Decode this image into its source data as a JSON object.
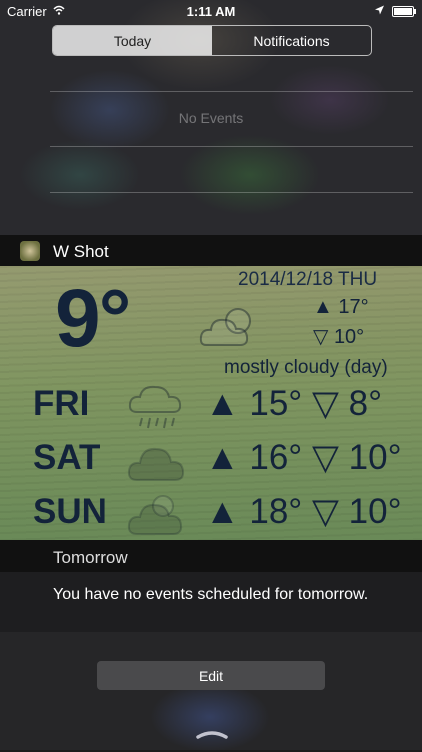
{
  "status": {
    "carrier": "Carrier",
    "time": "1:11 AM"
  },
  "tabs": {
    "today": "Today",
    "notifications": "Notifications"
  },
  "events": {
    "no_events": "No Events"
  },
  "widget": {
    "title": "W Shot",
    "date": "2014/12/18 THU",
    "current_temp": "9°",
    "high": "▲ 17°",
    "low": "▽ 10°",
    "condition": "mostly cloudy (day)",
    "forecast": [
      {
        "day": "FRI",
        "temps": "▲ 15° ▽ 8°",
        "icon": "rain-cloud-icon"
      },
      {
        "day": "SAT",
        "temps": "▲ 16° ▽ 10°",
        "icon": "cloud-icon"
      },
      {
        "day": "SUN",
        "temps": "▲ 18° ▽ 10°",
        "icon": "cloud-sun-icon"
      }
    ]
  },
  "tomorrow": {
    "label": "Tomorrow",
    "message": "You have no events scheduled for tomorrow."
  },
  "footer": {
    "edit_label": "Edit"
  }
}
